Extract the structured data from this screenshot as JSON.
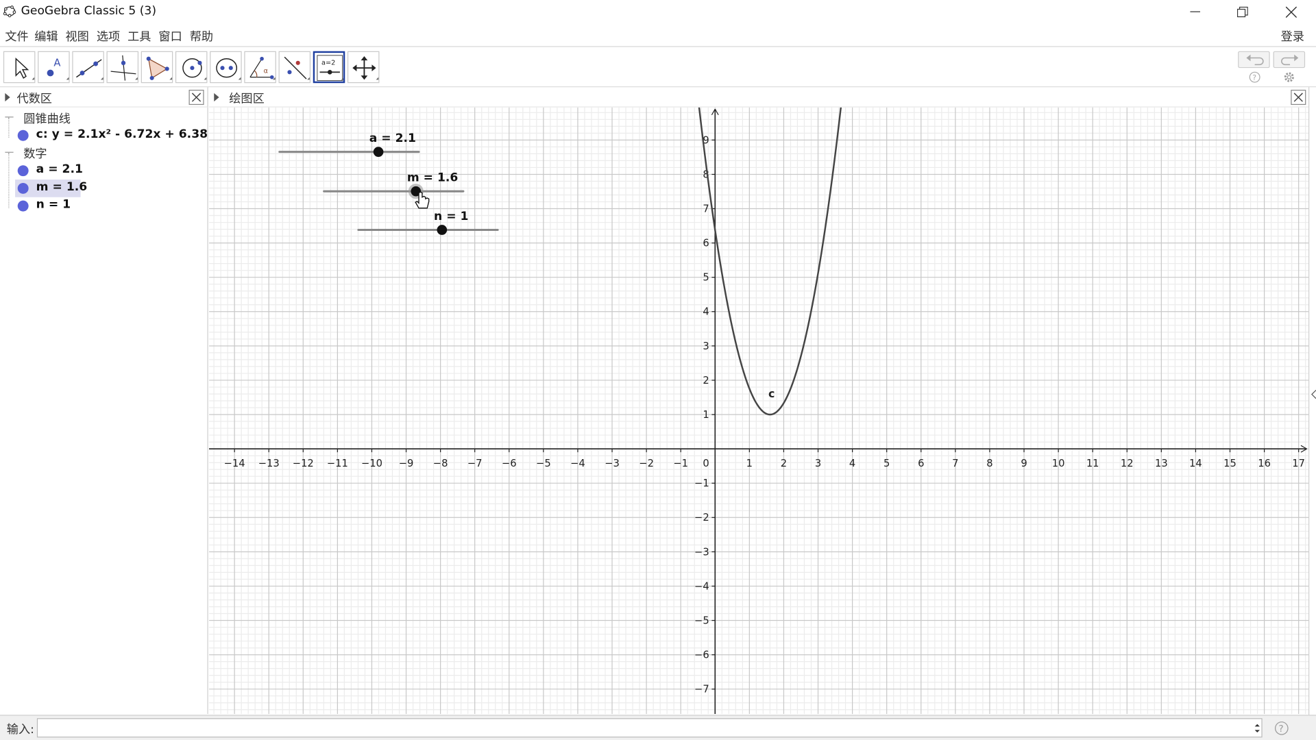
{
  "window": {
    "title": "GeoGebra Classic 5 (3)"
  },
  "menu": {
    "items": [
      "文件",
      "编辑",
      "视图",
      "选项",
      "工具",
      "窗口",
      "帮助"
    ],
    "login": "登录"
  },
  "toolbar": {
    "tools": [
      {
        "name": "move-tool",
        "icon": "arrow-pointer-icon"
      },
      {
        "name": "point-tool",
        "icon": "point-a-icon",
        "glyph": "A"
      },
      {
        "name": "line-tool",
        "icon": "line-through-points-icon"
      },
      {
        "name": "perpendicular-tool",
        "icon": "perpendicular-line-icon"
      },
      {
        "name": "polygon-tool",
        "icon": "polygon-icon"
      },
      {
        "name": "circle-tool",
        "icon": "circle-center-point-icon"
      },
      {
        "name": "ellipse-tool",
        "icon": "ellipse-icon"
      },
      {
        "name": "angle-tool",
        "icon": "angle-icon"
      },
      {
        "name": "reflect-tool",
        "icon": "reflect-line-icon"
      },
      {
        "name": "slider-tool",
        "icon": "slider-icon",
        "glyph": "a=2",
        "active": true
      },
      {
        "name": "move-graphics-view-tool",
        "icon": "move-view-icon"
      }
    ]
  },
  "algebra": {
    "header": "代数区",
    "groups": [
      {
        "label": "圆锥曲线",
        "items": [
          {
            "label": "c: y = 2.1x² - 6.72x + 6.38",
            "color": "#5b63d9",
            "selected": false
          }
        ]
      },
      {
        "label": "数字",
        "items": [
          {
            "label": "a = 2.1",
            "color": "#5b63d9",
            "selected": false
          },
          {
            "label": "m = 1.6",
            "color": "#5b63d9",
            "selected": true
          },
          {
            "label": "n = 1",
            "color": "#5b63d9",
            "selected": false
          }
        ]
      }
    ]
  },
  "graphics": {
    "header": "绘图区",
    "x_range": [
      -15,
      17.5
    ],
    "y_range": [
      -8,
      10
    ],
    "x_ticks": [
      -14,
      -13,
      -12,
      -11,
      -10,
      -9,
      -8,
      -7,
      -6,
      -5,
      -4,
      -3,
      -2,
      -1,
      1,
      2,
      3,
      4,
      5,
      6,
      7,
      8,
      9,
      10,
      11,
      12,
      13,
      14,
      15,
      16,
      17
    ],
    "y_ticks": [
      -7,
      -6,
      -5,
      -4,
      -3,
      -2,
      -1,
      1,
      2,
      3,
      4,
      5,
      6,
      7,
      8,
      9
    ],
    "origin_label": "0",
    "curve": {
      "label": "c",
      "a": 2.1,
      "m": 1.6,
      "n": 1,
      "color": "#444444"
    },
    "sliders": [
      {
        "label": "a = 2.1",
        "value": 2.1,
        "fraction": 0.71
      },
      {
        "label": "m = 1.6",
        "value": 1.6,
        "fraction": 0.66
      },
      {
        "label": "n = 1",
        "value": 1,
        "fraction": 0.6
      }
    ],
    "grid_major_color": "#c8c8c8",
    "grid_minor_color": "#ececec"
  },
  "input": {
    "label": "输入:",
    "value": "",
    "placeholder": ""
  }
}
